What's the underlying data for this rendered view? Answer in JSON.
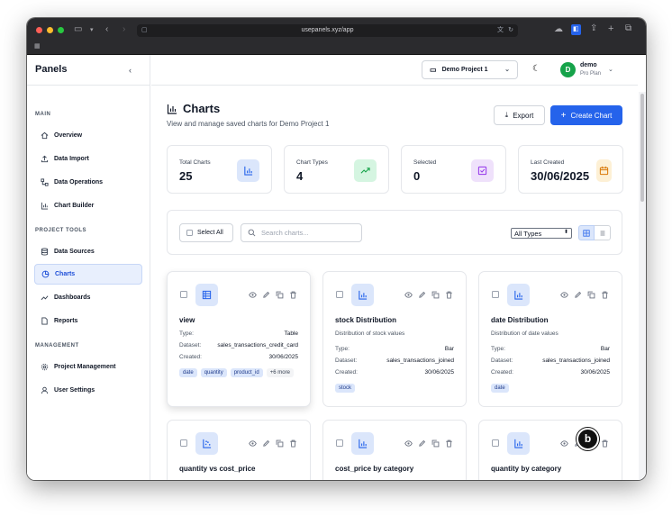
{
  "browser": {
    "url": "usepanels.xyz/app"
  },
  "sidebar": {
    "brand": "Panels",
    "sections": [
      {
        "title": "MAIN"
      },
      {
        "title": "PROJECT TOOLS"
      },
      {
        "title": "MANAGEMENT"
      }
    ],
    "items": [
      {
        "label": "Overview"
      },
      {
        "label": "Data Import"
      },
      {
        "label": "Data Operations"
      },
      {
        "label": "Chart Builder"
      },
      {
        "label": "Data Sources"
      },
      {
        "label": "Charts"
      },
      {
        "label": "Dashboards"
      },
      {
        "label": "Reports"
      },
      {
        "label": "Project Management"
      },
      {
        "label": "User Settings"
      }
    ]
  },
  "header": {
    "project": "Demo Project 1",
    "user": {
      "initial": "D",
      "name": "demo",
      "plan": "Pro Plan"
    }
  },
  "page": {
    "title": "Charts",
    "subtitle": "View and manage saved charts for Demo Project 1",
    "export_label": "Export",
    "create_label": "Create Chart"
  },
  "stats": [
    {
      "label": "Total Charts",
      "value": "25"
    },
    {
      "label": "Chart Types",
      "value": "4"
    },
    {
      "label": "Selected",
      "value": "0"
    },
    {
      "label": "Last Created",
      "value": "30/06/2025"
    }
  ],
  "toolbar": {
    "select_all": "Select All",
    "search_placeholder": "Search charts...",
    "type_filter": "All Types"
  },
  "field_labels": {
    "type": "Type:",
    "dataset": "Dataset:",
    "created": "Created:"
  },
  "cards": [
    {
      "title": "view",
      "description": "",
      "type": "Table",
      "dataset": "sales_transactions_credit_card",
      "created": "30/06/2025",
      "tags": [
        "date",
        "quantity",
        "product_id"
      ],
      "more": "+6 more"
    },
    {
      "title": "stock Distribution",
      "description": "Distribution of stock values",
      "type": "Bar",
      "dataset": "sales_transactions_joined",
      "created": "30/06/2025",
      "tags": [
        "stock"
      ]
    },
    {
      "title": "date Distribution",
      "description": "Distribution of date values",
      "type": "Bar",
      "dataset": "sales_transactions_joined",
      "created": "30/06/2025",
      "tags": [
        "date"
      ]
    },
    {
      "title": "quantity vs cost_price"
    },
    {
      "title": "cost_price by category"
    },
    {
      "title": "quantity by category"
    }
  ],
  "colors": {
    "accent": "#2563eb",
    "active_bg": "#e8effd",
    "avatar": "#16a34a"
  }
}
